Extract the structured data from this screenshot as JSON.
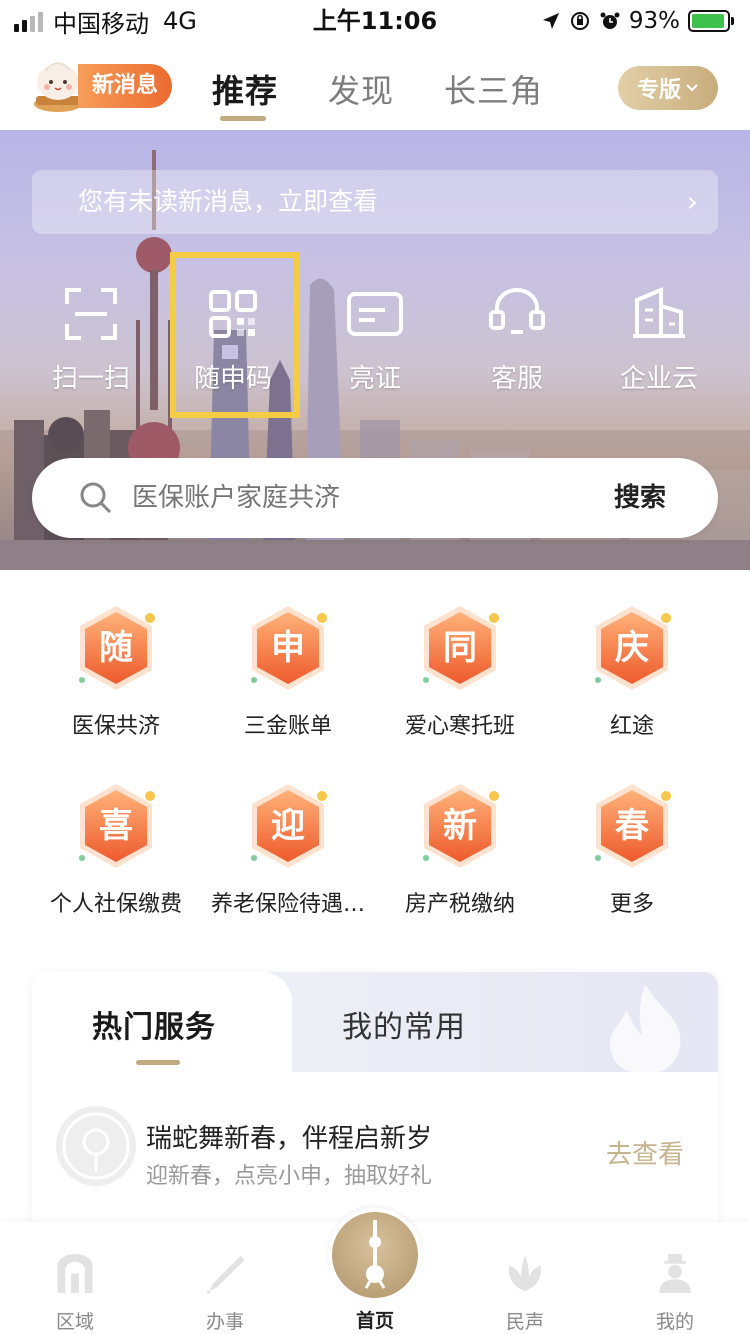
{
  "status_bar": {
    "carrier": "中国移动",
    "network": "4G",
    "time": "上午11:06",
    "battery": "93%",
    "battery_level": 0.93
  },
  "top_nav": {
    "message_pill": "新消息",
    "tabs": [
      {
        "label": "推荐",
        "active": true
      },
      {
        "label": "发现",
        "active": false
      },
      {
        "label": "长三角",
        "active": false
      }
    ],
    "edition_label": "专版"
  },
  "hero": {
    "notice": "您有未读新消息，立即查看",
    "quick_actions": [
      {
        "label": "扫一扫",
        "icon": "scan-icon"
      },
      {
        "label": "随申码",
        "icon": "qr-code-icon"
      },
      {
        "label": "亮证",
        "icon": "id-card-icon"
      },
      {
        "label": "客服",
        "icon": "headset-icon"
      },
      {
        "label": "企业云",
        "icon": "building-icon"
      }
    ],
    "search": {
      "placeholder": "医保账户家庭共济",
      "button": "搜索"
    }
  },
  "services": [
    {
      "char": "随",
      "label": "医保共济"
    },
    {
      "char": "申",
      "label": "三金账单"
    },
    {
      "char": "同",
      "label": "爱心寒托班"
    },
    {
      "char": "庆",
      "label": "红途"
    },
    {
      "char": "喜",
      "label": "个人社保缴费"
    },
    {
      "char": "迎",
      "label": "养老保险待遇…"
    },
    {
      "char": "新",
      "label": "房产税缴纳"
    },
    {
      "char": "春",
      "label": "更多"
    }
  ],
  "hot_card": {
    "tabs": [
      "热门服务",
      "我的常用"
    ],
    "promo": {
      "title": "瑞蛇舞新春，伴程启新岁",
      "subtitle": "迎新春，点亮小申，抽取好礼",
      "link": "去查看"
    }
  },
  "tabbar": [
    {
      "label": "区域",
      "icon": "region-icon"
    },
    {
      "label": "办事",
      "icon": "pen-icon"
    },
    {
      "label": "首页",
      "icon": "tower-icon"
    },
    {
      "label": "民声",
      "icon": "flower-icon"
    },
    {
      "label": "我的",
      "icon": "person-icon"
    }
  ],
  "colors": {
    "accent_gold": "#c2aa82",
    "highlight_yellow": "#f5cd45",
    "badge_orange": "#f27a3c"
  }
}
